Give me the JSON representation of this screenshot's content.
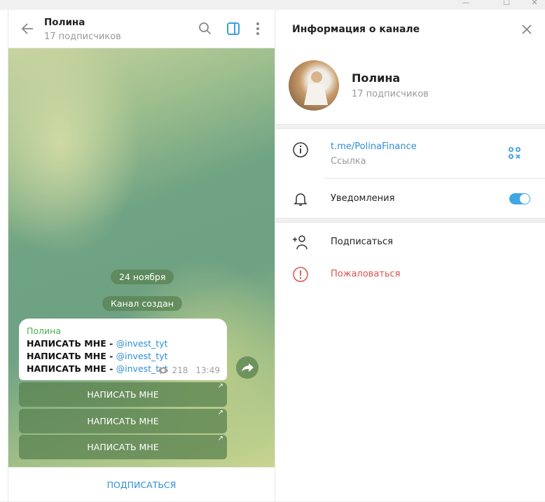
{
  "chat": {
    "title": "Полина",
    "subtitle": "17 подписчиков",
    "date": "24 ноября",
    "service": "Канал создан",
    "message": {
      "author": "Полина",
      "lines": [
        {
          "text": "НАПИСАТЬ МНЕ - ",
          "link": "@invest_tyt"
        },
        {
          "text": "НАПИСАТЬ МНЕ - ",
          "link": "@invest_tyt"
        },
        {
          "text": "НАПИСАТЬ МНЕ - ",
          "link": "@invest_tyt"
        }
      ],
      "views": "218",
      "time": "13:49"
    },
    "buttons": [
      "НАПИСАТЬ МНЕ",
      "НАПИСАТЬ МНЕ",
      "НАПИСАТЬ МНЕ"
    ],
    "subscribe": "ПОДПИСАТЬСЯ"
  },
  "info": {
    "title": "Информация о канале",
    "name": "Полина",
    "subtitle": "17 подписчиков",
    "link": "t.me/PolinaFinance",
    "link_label": "Ссылка",
    "notifications": "Уведомления",
    "notifications_on": true,
    "join": "Подписаться",
    "report": "Пожаловаться"
  },
  "colors": {
    "accent": "#2d8fd5",
    "author": "#4fae4e",
    "danger": "#d9534f",
    "toggle": "#40a7e3"
  }
}
